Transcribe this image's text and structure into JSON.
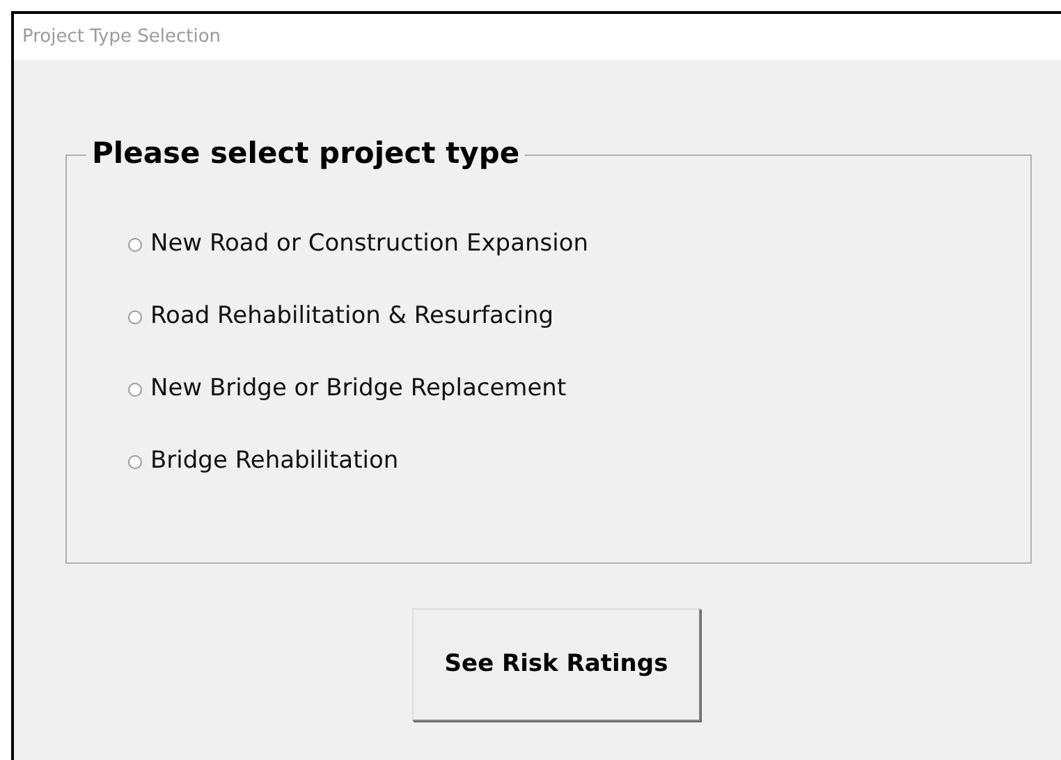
{
  "window": {
    "title": "Project Type Selection"
  },
  "group": {
    "title": "Please select project type",
    "options": [
      {
        "label": "New Road or Construction Expansion",
        "selected": false
      },
      {
        "label": "Road Rehabilitation & Resurfacing",
        "selected": false
      },
      {
        "label": "New Bridge or Bridge Replacement",
        "selected": false
      },
      {
        "label": "Bridge Rehabilitation",
        "selected": false
      }
    ]
  },
  "buttons": [
    "See Risk Ratings"
  ]
}
